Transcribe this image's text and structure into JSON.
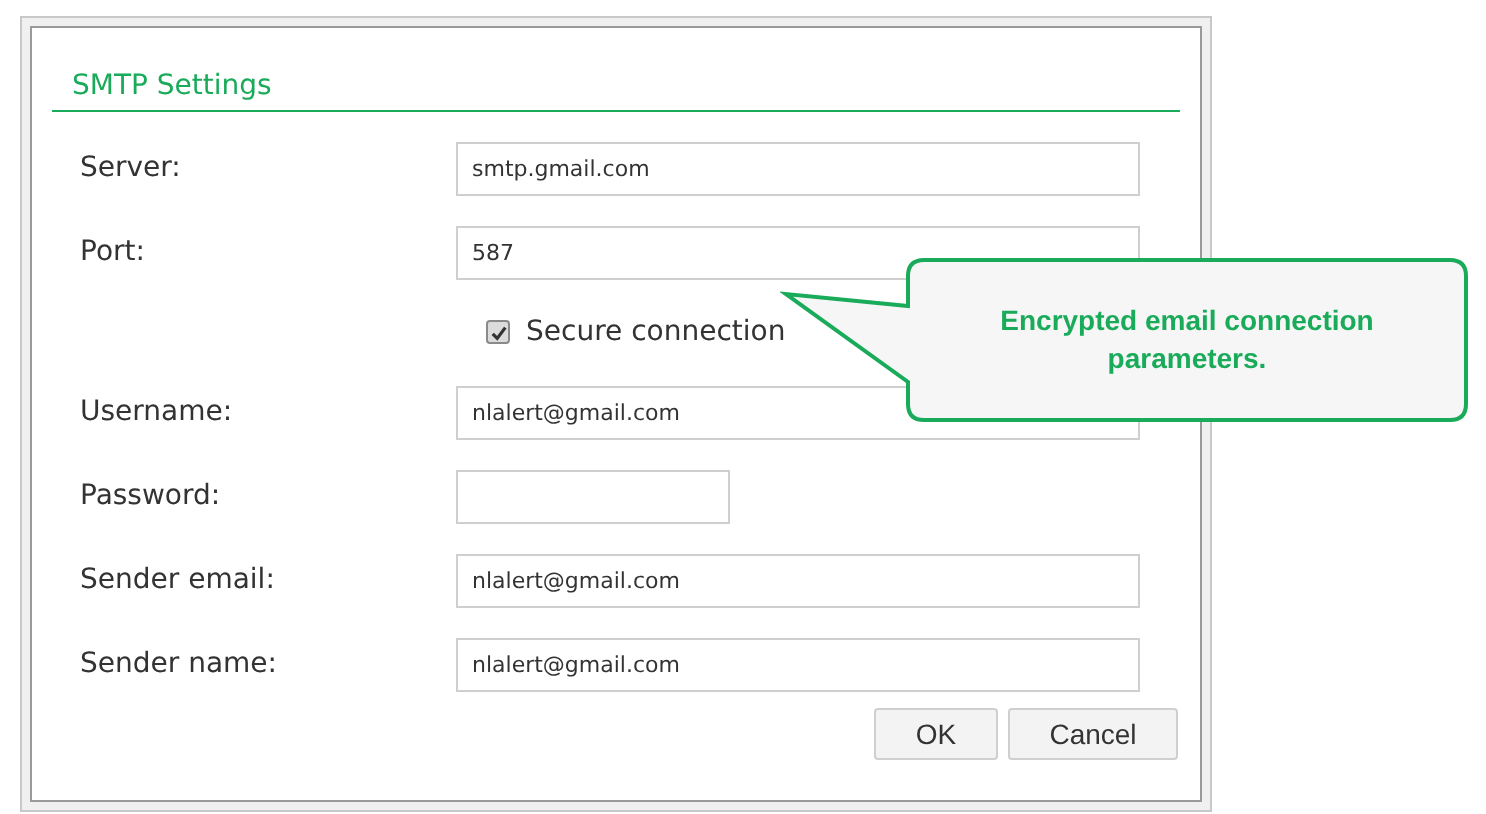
{
  "dialog": {
    "title": "SMTP Settings",
    "rows": [
      {
        "kind": "text",
        "label": "Server:",
        "value": "smtp.gmail.com"
      },
      {
        "kind": "text",
        "label": "Port:",
        "value": "587"
      },
      {
        "kind": "checkbox",
        "label": "Secure connection",
        "checked": true
      },
      {
        "kind": "text",
        "label": "Username:",
        "value": "nlalert@gmail.com"
      },
      {
        "kind": "short",
        "label": "Password:"
      },
      {
        "kind": "text",
        "label": "Sender email:",
        "value": "nlalert@gmail.com"
      },
      {
        "kind": "text",
        "label": "Sender name:",
        "value": "nlalert@gmail.com"
      }
    ],
    "buttons": [
      "OK",
      "Cancel"
    ]
  },
  "callout": {
    "text": "Encrypted email connection parameters."
  }
}
